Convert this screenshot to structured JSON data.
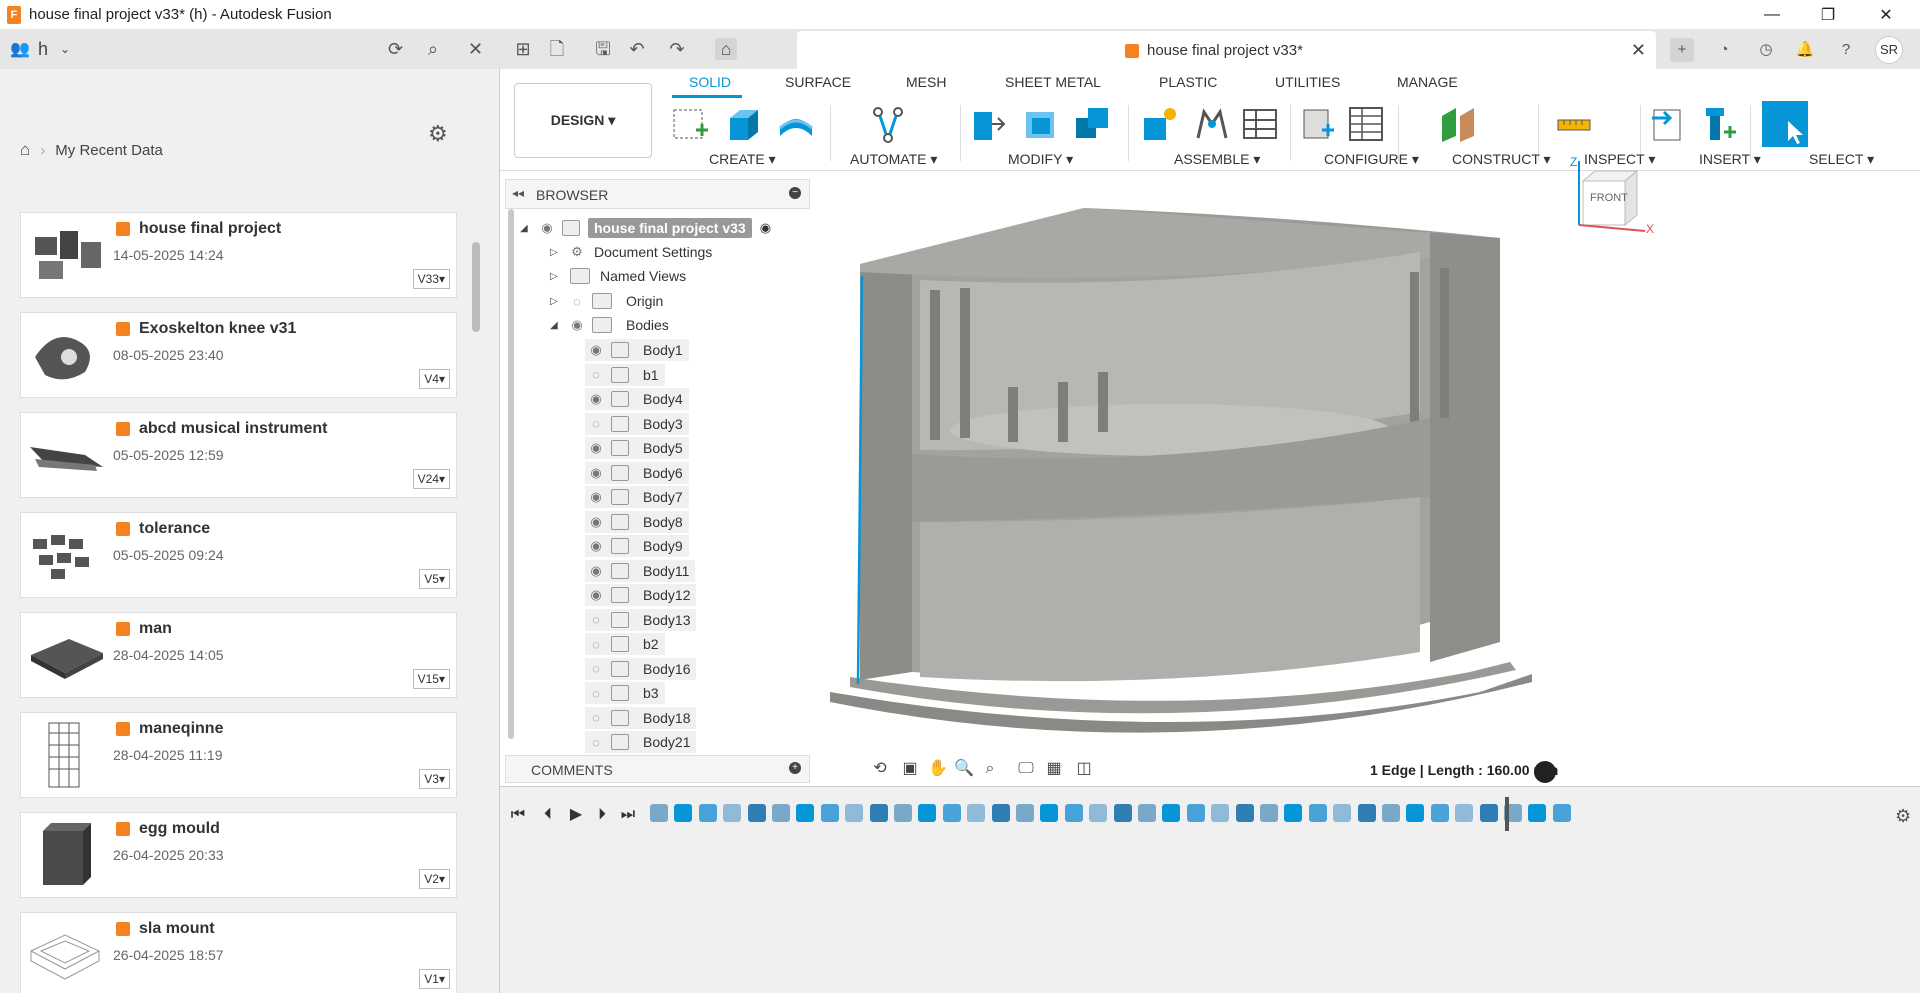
{
  "titlebar": {
    "title": "house final project v33* (h) - Autodesk Fusion",
    "app_logo": "F",
    "minimize": "—",
    "maximize": "❐",
    "close": "✕"
  },
  "data_panel": {
    "team_name": "h",
    "breadcrumb": "My Recent Data",
    "items": [
      {
        "name": "house final project",
        "date": "14-05-2025 14:24",
        "version": "V33▾"
      },
      {
        "name": "Exoskelton knee v31",
        "date": "08-05-2025 23:40",
        "version": "V4▾"
      },
      {
        "name": "abcd musical instrument",
        "date": "05-05-2025 12:59",
        "version": "V24▾"
      },
      {
        "name": "tolerance",
        "date": "05-05-2025 09:24",
        "version": "V5▾"
      },
      {
        "name": "man",
        "date": "28-04-2025 14:05",
        "version": "V15▾"
      },
      {
        "name": "maneqinne",
        "date": "28-04-2025 11:19",
        "version": "V3▾"
      },
      {
        "name": "egg mould",
        "date": "26-04-2025 20:33",
        "version": "V2▾"
      },
      {
        "name": "sla mount",
        "date": "26-04-2025 18:57",
        "version": "V1▾"
      }
    ]
  },
  "doc_tab": {
    "title": "house final project v33*",
    "close": "✕"
  },
  "avatar": "SR",
  "ribbon": {
    "design": "DESIGN ▾",
    "tabs": [
      "SOLID",
      "SURFACE",
      "MESH",
      "SHEET METAL",
      "PLASTIC",
      "UTILITIES",
      "MANAGE"
    ],
    "groups": [
      "CREATE ▾",
      "AUTOMATE ▾",
      "MODIFY ▾",
      "ASSEMBLE ▾",
      "CONFIGURE ▾",
      "CONSTRUCT ▾",
      "INSPECT ▾",
      "INSERT ▾",
      "SELECT ▾"
    ]
  },
  "browser": {
    "label": "BROWSER",
    "root": "house final project v33",
    "folders": [
      "Document Settings",
      "Named Views",
      "Origin",
      "Bodies"
    ],
    "bodies": [
      "Body1",
      "b1",
      "Body4",
      "Body3",
      "Body5",
      "Body6",
      "Body7",
      "Body8",
      "Body9",
      "Body11",
      "Body12",
      "Body13",
      "b2",
      "Body16",
      "b3",
      "Body18",
      "Body21"
    ]
  },
  "comments": {
    "label": "COMMENTS"
  },
  "viewcube": {
    "face": "FRONT",
    "z": "Z",
    "x": "X"
  },
  "status": {
    "text": "1 Edge | Length : 160.00 mm"
  },
  "colors": {
    "accent": "#0696d7",
    "brand": "#f58220"
  }
}
